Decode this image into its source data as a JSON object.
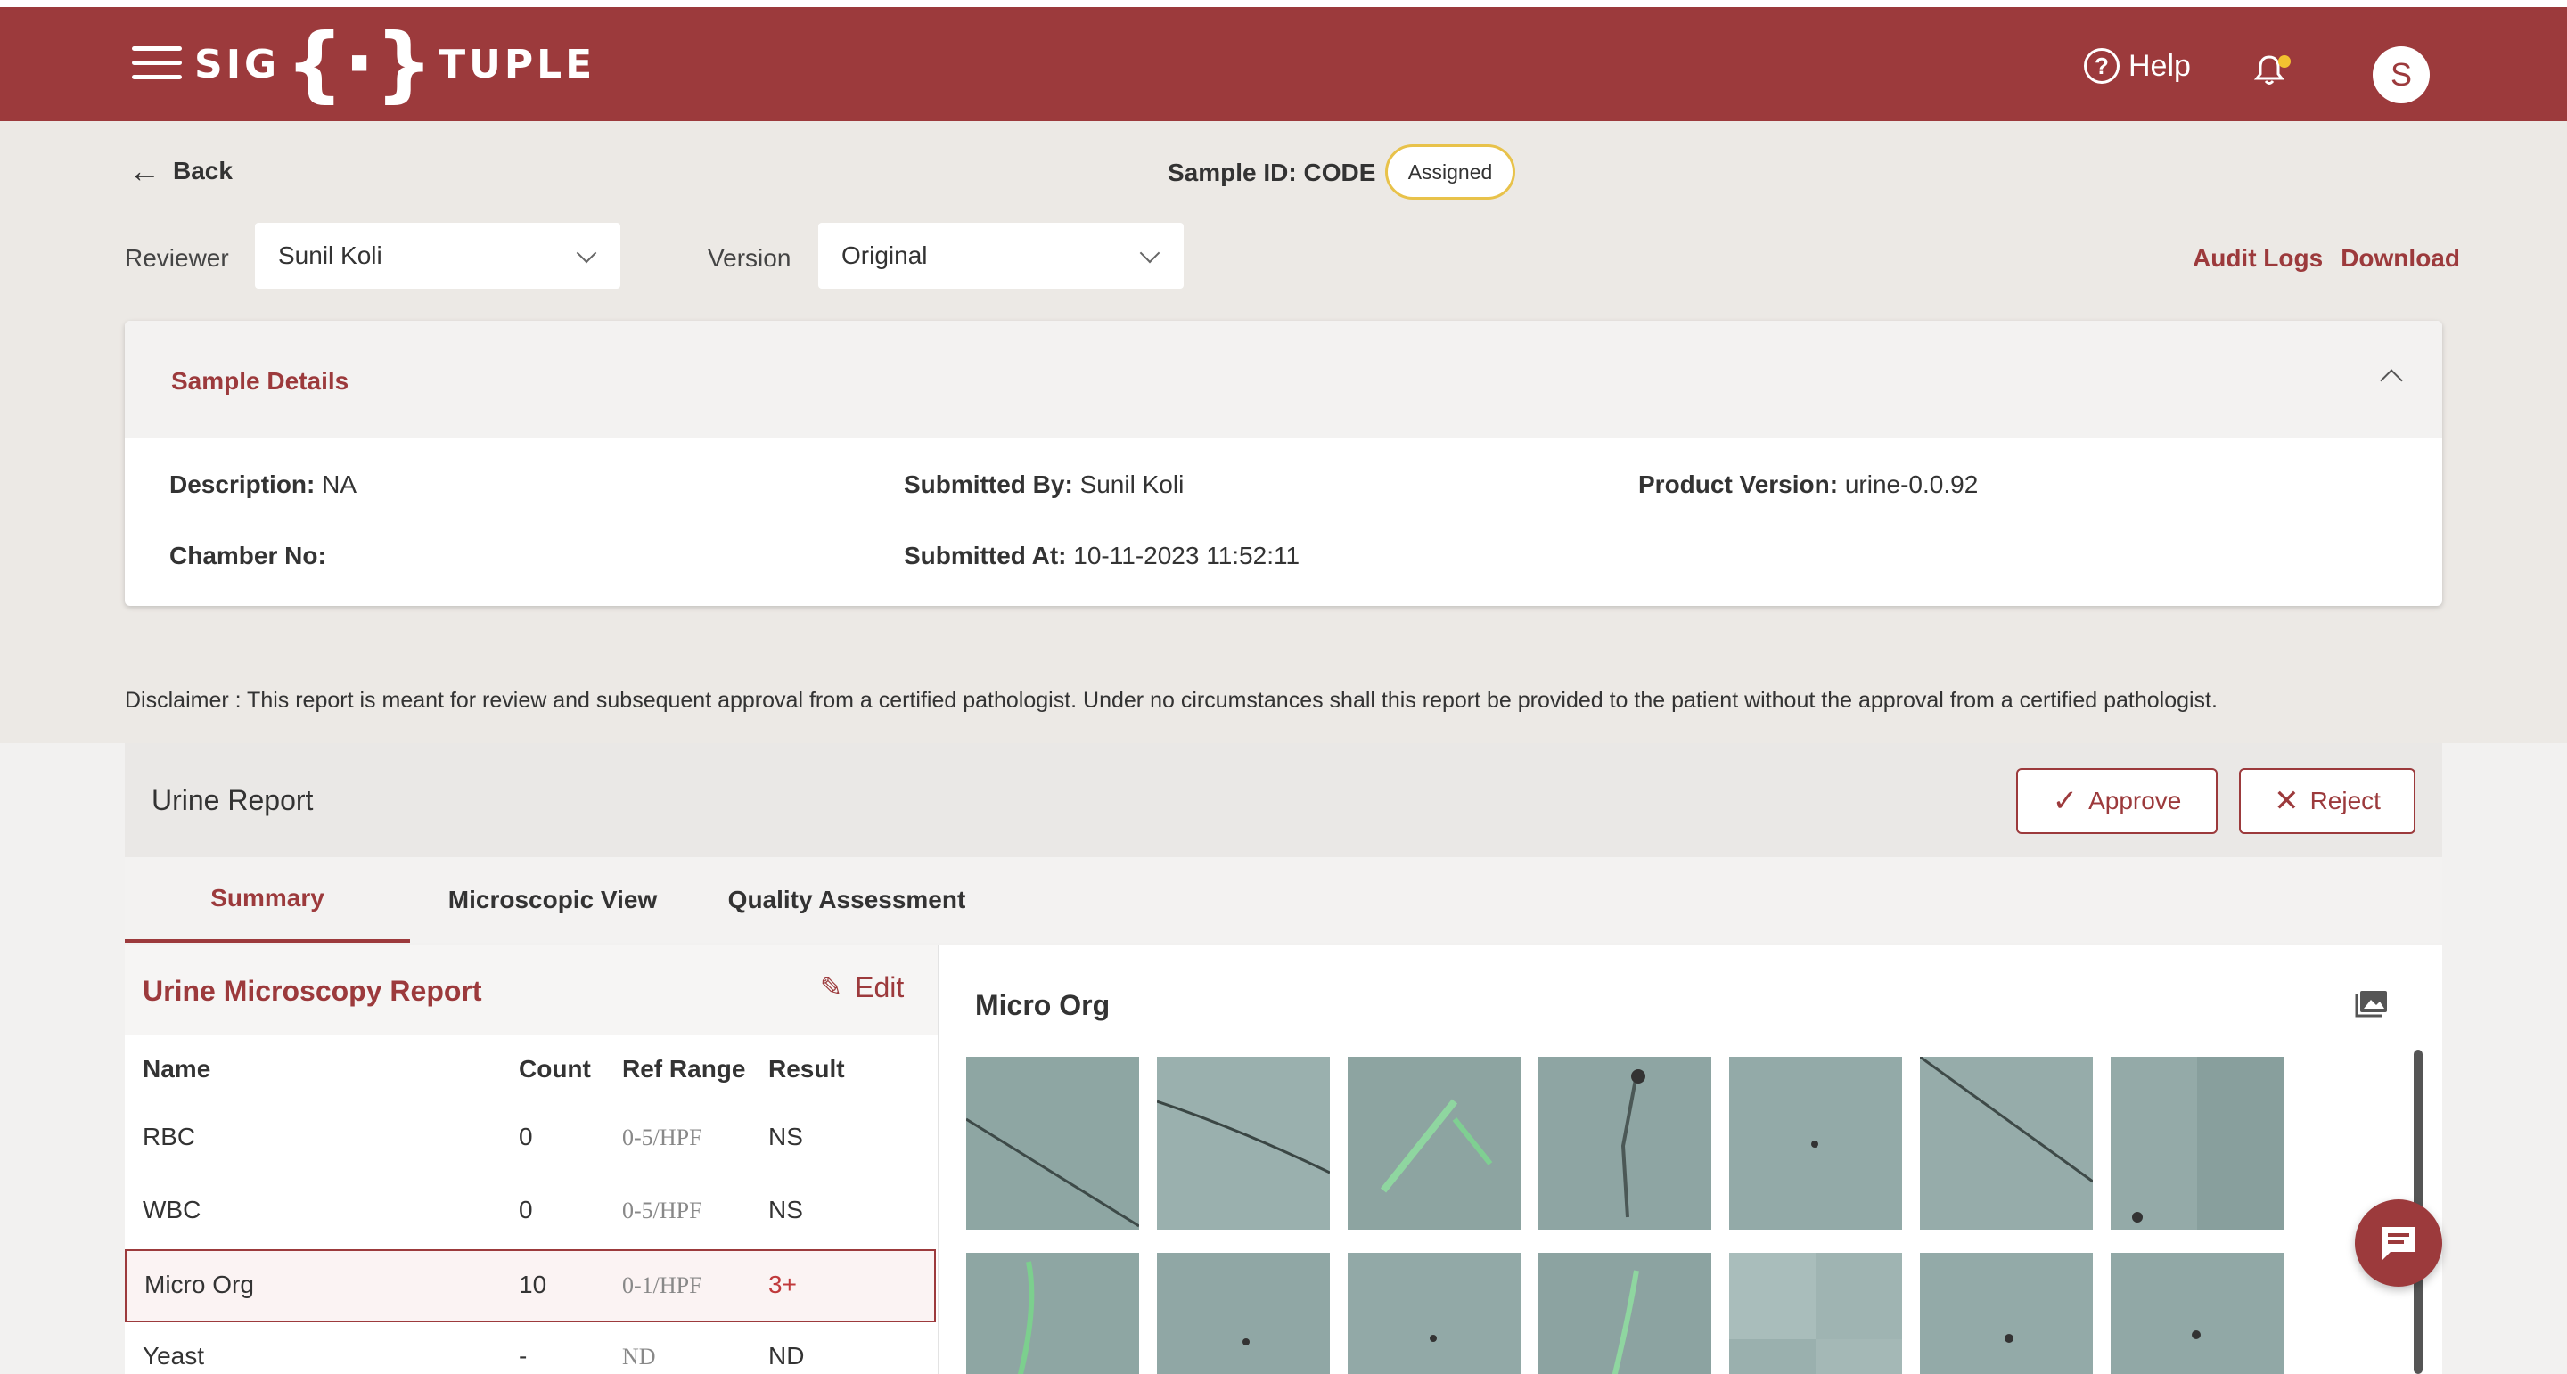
{
  "header": {
    "brand_left": "SIG",
    "brand_right": "TUPLE",
    "help_label": "Help",
    "avatar_initial": "S"
  },
  "page": {
    "back_label": "Back",
    "sample_id": "Sample ID: CODE",
    "status": "Assigned"
  },
  "filters": {
    "reviewer_label": "Reviewer",
    "reviewer_value": "Sunil Koli",
    "version_label": "Version",
    "version_value": "Original",
    "audit_logs": "Audit Logs",
    "download": "Download"
  },
  "sample_details": {
    "title": "Sample Details",
    "description_label": "Description:",
    "description_value": "NA",
    "submitted_by_label": "Submitted By:",
    "submitted_by_value": "Sunil Koli",
    "product_version_label": "Product Version:",
    "product_version_value": "urine-0.0.92",
    "chamber_label": "Chamber No:",
    "chamber_value": "",
    "submitted_at_label": "Submitted At:",
    "submitted_at_value": "10-11-2023 11:52:11"
  },
  "disclaimer": "Disclaimer :  This report is meant for review and subsequent approval from a certified pathologist. Under no circumstances shall this report be provided to the patient without the approval from a certified pathologist.",
  "report": {
    "title": "Urine Report",
    "approve": "Approve",
    "reject": "Reject",
    "tabs": [
      "Summary",
      "Microscopic View",
      "Quality Assessment"
    ]
  },
  "microscopy": {
    "title": "Urine Microscopy Report",
    "edit": "Edit",
    "columns": [
      "Name",
      "Count",
      "Ref Range",
      "Result"
    ],
    "rows": [
      {
        "name": "RBC",
        "count": "0",
        "ref": "0-5/HPF",
        "result": "NS"
      },
      {
        "name": "WBC",
        "count": "0",
        "ref": "0-5/HPF",
        "result": "NS"
      },
      {
        "name": "Micro Org",
        "count": "10",
        "ref": "0-1/HPF",
        "result": "3+"
      },
      {
        "name": "Yeast",
        "count": "-",
        "ref": "ND",
        "result": "ND"
      }
    ]
  },
  "gallery": {
    "title": "Micro Org"
  },
  "colors": {
    "brand": "#9c3a3c",
    "badge_border": "#e8c24a",
    "highlight_result": "#c0393b"
  }
}
